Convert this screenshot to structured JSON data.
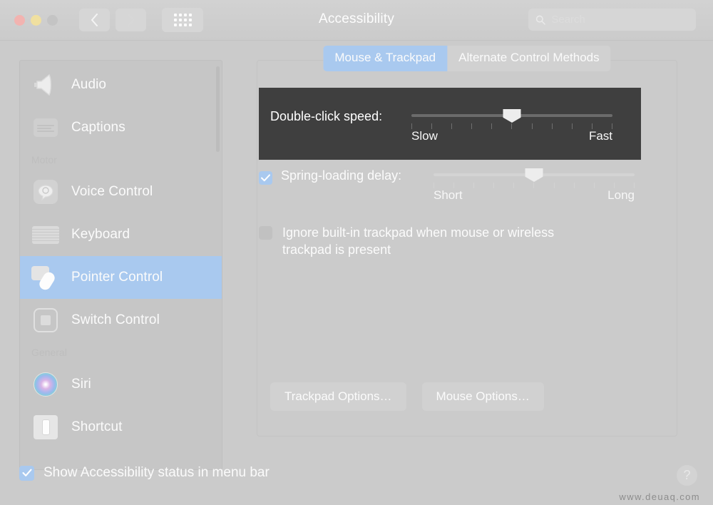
{
  "window": {
    "title": "Accessibility",
    "traffic_lights": [
      {
        "name": "close",
        "color": "#f2b3b0"
      },
      {
        "name": "minimize",
        "color": "#f0e0a0"
      },
      {
        "name": "zoom",
        "color": "#c4c4c4"
      }
    ],
    "nav": {
      "back": "‹",
      "forward": "›",
      "show_all": "grid-icon"
    }
  },
  "search": {
    "value": "",
    "placeholder": "Search"
  },
  "sidebar": {
    "items": [
      {
        "label": "Audio",
        "icon": "speaker-icon",
        "type": "item",
        "selected": false
      },
      {
        "label": "Captions",
        "icon": "captions-icon",
        "type": "item",
        "selected": false
      },
      {
        "label": "Motor",
        "icon": "",
        "type": "section",
        "selected": false
      },
      {
        "label": "Voice Control",
        "icon": "voice-control-icon",
        "type": "item",
        "selected": false
      },
      {
        "label": "Keyboard",
        "icon": "keyboard-icon",
        "type": "item",
        "selected": false
      },
      {
        "label": "Pointer Control",
        "icon": "pointer-control-icon",
        "type": "item",
        "selected": true
      },
      {
        "label": "Switch Control",
        "icon": "switch-control-icon",
        "type": "item",
        "selected": false
      },
      {
        "label": "General",
        "icon": "",
        "type": "section",
        "selected": false
      },
      {
        "label": "Siri",
        "icon": "siri-icon",
        "type": "item",
        "selected": false
      },
      {
        "label": "Shortcut",
        "icon": "shortcut-icon",
        "type": "item",
        "selected": false
      }
    ]
  },
  "main": {
    "tabs": [
      {
        "label": "Mouse & Trackpad",
        "active": true
      },
      {
        "label": "Alternate Control Methods",
        "active": false
      }
    ],
    "double_click": {
      "label": "Double-click speed:",
      "min_label": "Slow",
      "max_label": "Fast",
      "value_percent": 50,
      "tick_count": 11,
      "highlighted": true,
      "highlight_color": "#3f3f3f"
    },
    "spring_loading": {
      "label": "Spring-loading delay:",
      "checked": true,
      "min_label": "Short",
      "max_label": "Long",
      "value_percent": 50,
      "tick_count": 11
    },
    "ignore_trackpad": {
      "label": "Ignore built-in trackpad when mouse or wireless trackpad is present",
      "checked": false
    },
    "buttons": [
      {
        "label": "Trackpad Options…"
      },
      {
        "label": "Mouse Options…"
      }
    ]
  },
  "footer": {
    "show_status": {
      "label": "Show Accessibility status in menu bar",
      "checked": true
    },
    "help_label": "?",
    "watermark": "www.deuaq.com"
  },
  "colors": {
    "accent": "#a9c9ef",
    "background": "#cbcbcb",
    "sidebar": "#c6c6c6",
    "highlight_overlay": "#3f3f3f"
  }
}
